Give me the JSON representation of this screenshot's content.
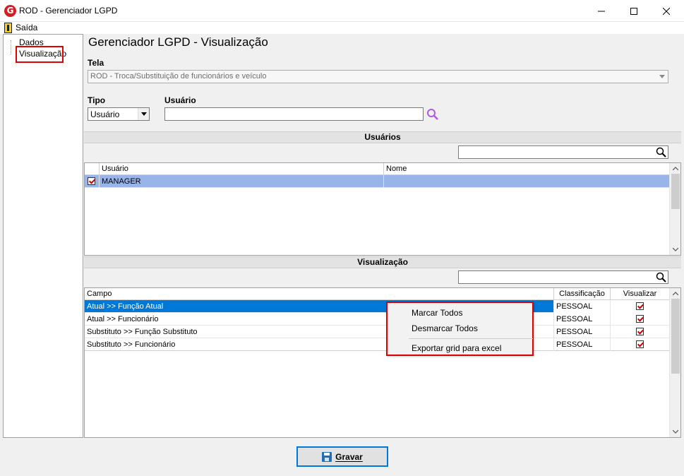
{
  "window": {
    "title": "ROD - Gerenciador LGPD",
    "icon_letter": "G"
  },
  "menu": {
    "exit_label": "Saída"
  },
  "tree": {
    "items": [
      {
        "label": "Dados"
      },
      {
        "label": "Visualização",
        "selected": true
      }
    ]
  },
  "panel": {
    "title": "Gerenciador LGPD - Visualização",
    "tela_label": "Tela",
    "tela_value": "ROD - Troca/Substituição de funcionários e veículo",
    "tipo_label": "Tipo",
    "tipo_value": "Usuário",
    "usuario_label": "Usuário",
    "usuario_value": ""
  },
  "usuarios": {
    "section_title": "Usuários",
    "search_value": "",
    "columns": [
      "Usuário",
      "Nome"
    ],
    "rows": [
      {
        "checked": true,
        "usuario": "MANAGER",
        "nome": ""
      }
    ]
  },
  "visualizacao": {
    "section_title": "Visualização",
    "search_value": "",
    "columns": [
      "Campo",
      "Classificação",
      "Visualizar"
    ],
    "rows": [
      {
        "campo": "Atual >> Função Atual",
        "classificacao": "PESSOAL",
        "visualizar": true
      },
      {
        "campo": "Atual >> Funcionário",
        "classificacao": "PESSOAL",
        "visualizar": true
      },
      {
        "campo": "Substituto >> Função Substituto",
        "classificacao": "PESSOAL",
        "visualizar": true
      },
      {
        "campo": "Substituto >> Funcionário",
        "classificacao": "PESSOAL",
        "visualizar": true
      }
    ]
  },
  "context_menu": {
    "items": [
      "Marcar Todos",
      "Desmarcar Todos",
      "Exportar grid para excel"
    ]
  },
  "footer": {
    "save_label": "Gravar"
  },
  "colors": {
    "selection_blue": "#0078d7",
    "row_highlight": "#99b4e8",
    "highlight_border": "#e00000",
    "check_red": "#cc0000",
    "logo_red": "#d21f26"
  }
}
